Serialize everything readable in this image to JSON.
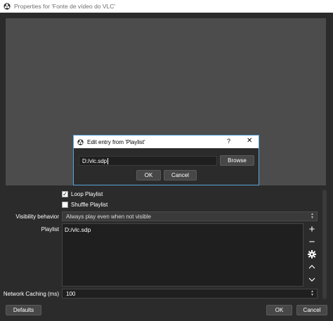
{
  "window": {
    "title": "Properties for 'Fonte de vídeo do VLC'"
  },
  "options": {
    "loop_label": "Loop Playlist",
    "loop_checked": true,
    "shuffle_label": "Shuffle Playlist",
    "shuffle_checked": false
  },
  "visibility": {
    "label": "Visibility behavior",
    "value": "Always play even when not visible"
  },
  "playlist": {
    "label": "Playlist",
    "items": [
      "D:/vlc.sdp"
    ]
  },
  "caching": {
    "label": "Network Caching (ms)",
    "value": "100"
  },
  "footer": {
    "defaults_label": "Defaults",
    "ok_label": "OK",
    "cancel_label": "Cancel"
  },
  "dialog": {
    "title": "Edit entry from 'Playlist'",
    "help": "?",
    "close": "✕",
    "entry_value": "D:/vlc.sdp",
    "browse_label": "Browse",
    "ok_label": "OK",
    "cancel_label": "Cancel"
  },
  "icons": {
    "add": "+",
    "remove": "−",
    "up": "⌃",
    "down": "⌄",
    "check": "✓"
  }
}
